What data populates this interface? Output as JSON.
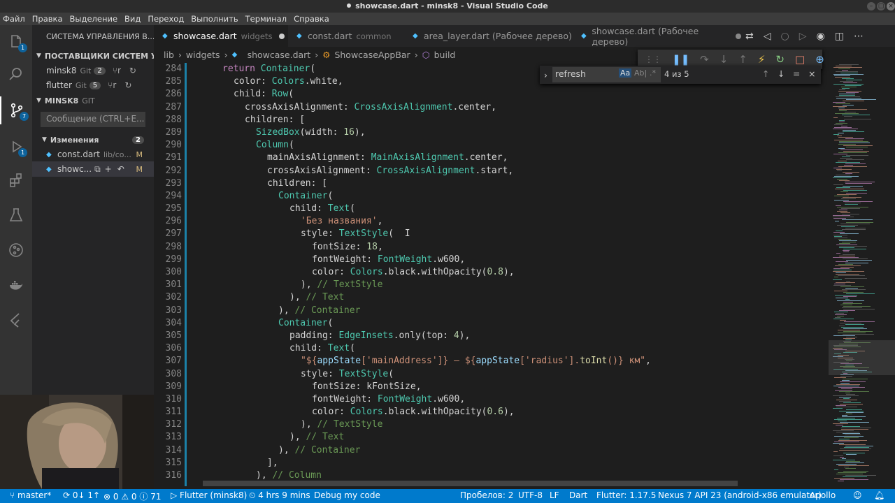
{
  "window": {
    "title": "showcase.dart - minsk8 - Visual Studio Code"
  },
  "menu": [
    "Файл",
    "Правка",
    "Выделение",
    "Вид",
    "Переход",
    "Выполнить",
    "Терминал",
    "Справка"
  ],
  "sidebar": {
    "title": "СИСТЕМА УПРАВЛЕНИЯ В...",
    "providers_header": "ПОСТАВЩИКИ СИСТЕМ УП...",
    "providers": [
      {
        "name": "minsk8",
        "type": "Git",
        "count": "2"
      },
      {
        "name": "flutter",
        "type": "Git",
        "count": "5"
      }
    ],
    "repo_name": "MINSK8",
    "repo_type": "GIT",
    "commit_placeholder": "Сообщение (CTRL+E...",
    "changes_label": "Изменения",
    "changes_count": "2",
    "changes": [
      {
        "name": "const.dart",
        "path": "lib/co...",
        "status": "M"
      },
      {
        "name": "showc...",
        "path": "",
        "status": "M"
      }
    ]
  },
  "tabs": [
    {
      "label": "showcase.dart",
      "hint": "widgets",
      "modified": true,
      "active": true
    },
    {
      "label": "const.dart",
      "hint": "common",
      "modified": false,
      "active": false
    },
    {
      "label": "area_layer.dart (Рабочее дерево)",
      "hint": "",
      "modified": false,
      "active": false
    },
    {
      "label": "showcase.dart (Рабочее дерево)",
      "hint": "",
      "modified": true,
      "active": false
    }
  ],
  "breadcrumb": [
    "lib",
    "widgets",
    "showcase.dart",
    "ShowcaseAppBar",
    "build"
  ],
  "find": {
    "value": "refresh",
    "match_case": "Aa",
    "whole_word": "Ab|",
    "regex": ".*",
    "result": "4 из 5"
  },
  "code": {
    "lines": [
      {
        "n": "284",
        "indent": 3,
        "tokens": [
          [
            "k",
            "return "
          ],
          [
            "t",
            "Container"
          ],
          [
            "",
            "("
          ]
        ]
      },
      {
        "n": "285",
        "indent": 4,
        "tokens": [
          [
            "",
            "color: "
          ],
          [
            "t",
            "Colors"
          ],
          [
            "",
            ".white,"
          ]
        ]
      },
      {
        "n": "286",
        "indent": 4,
        "tokens": [
          [
            "",
            "child: "
          ],
          [
            "t",
            "Row"
          ],
          [
            "",
            "("
          ]
        ]
      },
      {
        "n": "287",
        "indent": 5,
        "tokens": [
          [
            "",
            "crossAxisAlignment: "
          ],
          [
            "t",
            "CrossAxisAlignment"
          ],
          [
            "",
            ".center,"
          ]
        ]
      },
      {
        "n": "288",
        "indent": 5,
        "tokens": [
          [
            "",
            "children: ["
          ]
        ]
      },
      {
        "n": "289",
        "indent": 6,
        "tokens": [
          [
            "t",
            "SizedBox"
          ],
          [
            "",
            "(width: "
          ],
          [
            "n",
            "16"
          ],
          [
            "",
            "),"
          ]
        ]
      },
      {
        "n": "290",
        "indent": 6,
        "tokens": [
          [
            "t",
            "Column"
          ],
          [
            "",
            "("
          ]
        ]
      },
      {
        "n": "291",
        "indent": 7,
        "tokens": [
          [
            "",
            "mainAxisAlignment: "
          ],
          [
            "t",
            "MainAxisAlignment"
          ],
          [
            "",
            ".center,"
          ]
        ]
      },
      {
        "n": "292",
        "indent": 7,
        "tokens": [
          [
            "",
            "crossAxisAlignment: "
          ],
          [
            "t",
            "CrossAxisAlignment"
          ],
          [
            "",
            ".start,"
          ]
        ]
      },
      {
        "n": "293",
        "indent": 7,
        "tokens": [
          [
            "",
            "children: ["
          ]
        ]
      },
      {
        "n": "294",
        "indent": 8,
        "tokens": [
          [
            "t",
            "Container"
          ],
          [
            "",
            "("
          ]
        ]
      },
      {
        "n": "295",
        "indent": 9,
        "tokens": [
          [
            "",
            "child: "
          ],
          [
            "t",
            "Text"
          ],
          [
            "",
            "("
          ]
        ]
      },
      {
        "n": "296",
        "indent": 10,
        "tokens": [
          [
            "s",
            "'Без названия'"
          ],
          [
            "",
            ","
          ]
        ]
      },
      {
        "n": "297",
        "indent": 10,
        "tokens": [
          [
            "",
            "style: "
          ],
          [
            "t",
            "TextStyle"
          ],
          [
            "",
            "(  I"
          ]
        ]
      },
      {
        "n": "298",
        "indent": 11,
        "tokens": [
          [
            "",
            "fontSize: "
          ],
          [
            "n",
            "18"
          ],
          [
            "",
            ","
          ]
        ]
      },
      {
        "n": "299",
        "indent": 11,
        "tokens": [
          [
            "",
            "fontWeight: "
          ],
          [
            "t",
            "FontWeight"
          ],
          [
            "",
            ".w600,"
          ]
        ]
      },
      {
        "n": "300",
        "indent": 11,
        "tokens": [
          [
            "",
            "color: "
          ],
          [
            "t",
            "Colors"
          ],
          [
            "",
            ".black.withOpacity("
          ],
          [
            "n",
            "0.8"
          ],
          [
            "",
            "),"
          ]
        ]
      },
      {
        "n": "301",
        "indent": 10,
        "tokens": [
          [
            "",
            "), "
          ],
          [
            "c",
            "// TextStyle"
          ]
        ]
      },
      {
        "n": "302",
        "indent": 9,
        "tokens": [
          [
            "",
            "), "
          ],
          [
            "c",
            "// Text"
          ]
        ]
      },
      {
        "n": "303",
        "indent": 8,
        "tokens": [
          [
            "",
            "), "
          ],
          [
            "c",
            "// Container"
          ]
        ]
      },
      {
        "n": "304",
        "indent": 8,
        "tokens": [
          [
            "t",
            "Container"
          ],
          [
            "",
            "("
          ]
        ]
      },
      {
        "n": "305",
        "indent": 9,
        "tokens": [
          [
            "",
            "padding: "
          ],
          [
            "t",
            "EdgeInsets"
          ],
          [
            "",
            ".only(top: "
          ],
          [
            "n",
            "4"
          ],
          [
            "",
            "),"
          ]
        ]
      },
      {
        "n": "306",
        "indent": 9,
        "tokens": [
          [
            "",
            "child: "
          ],
          [
            "t",
            "Text"
          ],
          [
            "",
            "("
          ]
        ]
      },
      {
        "n": "307",
        "indent": 10,
        "tokens": [
          [
            "s",
            "\"${"
          ],
          [
            "p",
            "appState"
          ],
          [
            "s",
            "['mainAddress']} – ${"
          ],
          [
            "p",
            "appState"
          ],
          [
            "s",
            "['radius']."
          ],
          [
            "f",
            "toInt"
          ],
          [
            "s",
            "()} км\""
          ],
          [
            "",
            ","
          ]
        ]
      },
      {
        "n": "308",
        "indent": 10,
        "tokens": [
          [
            "",
            "style: "
          ],
          [
            "t",
            "TextStyle"
          ],
          [
            "",
            "("
          ]
        ]
      },
      {
        "n": "309",
        "indent": 11,
        "tokens": [
          [
            "",
            "fontSize: kFontSize,"
          ]
        ]
      },
      {
        "n": "310",
        "indent": 11,
        "tokens": [
          [
            "",
            "fontWeight: "
          ],
          [
            "t",
            "FontWeight"
          ],
          [
            "",
            ".w600,"
          ]
        ]
      },
      {
        "n": "311",
        "indent": 11,
        "tokens": [
          [
            "",
            "color: "
          ],
          [
            "t",
            "Colors"
          ],
          [
            "",
            ".black.withOpacity("
          ],
          [
            "n",
            "0.6"
          ],
          [
            "",
            "),"
          ]
        ]
      },
      {
        "n": "312",
        "indent": 10,
        "tokens": [
          [
            "",
            "), "
          ],
          [
            "c",
            "// TextStyle"
          ]
        ]
      },
      {
        "n": "313",
        "indent": 9,
        "tokens": [
          [
            "",
            "), "
          ],
          [
            "c",
            "// Text"
          ]
        ]
      },
      {
        "n": "314",
        "indent": 8,
        "tokens": [
          [
            "",
            "), "
          ],
          [
            "c",
            "// Container"
          ]
        ]
      },
      {
        "n": "315",
        "indent": 7,
        "tokens": [
          [
            "",
            "],"
          ]
        ]
      },
      {
        "n": "316",
        "indent": 6,
        "tokens": [
          [
            "",
            "), "
          ],
          [
            "c",
            "// Column"
          ]
        ]
      }
    ]
  },
  "status": {
    "branch": "master*",
    "sync": "0↓ 1↑",
    "errors": "0",
    "warnings": "0",
    "infos": "71",
    "flutter_run": "Flutter (minsk8)",
    "time": "4 hrs 9 mins",
    "debug": "Debug my code",
    "spaces": "Пробелов: 2",
    "encoding": "UTF-8",
    "eol": "LF",
    "language": "Dart",
    "flutter_version": "Flutter: 1.17.5",
    "device": "Nexus 7 API 23 (android-x86 emulator)",
    "extra": "Apollo"
  },
  "colors": {
    "statusbar": "#007acc",
    "editor": "#1e1e1e",
    "sidebar": "#252526",
    "activitybar": "#333333"
  }
}
